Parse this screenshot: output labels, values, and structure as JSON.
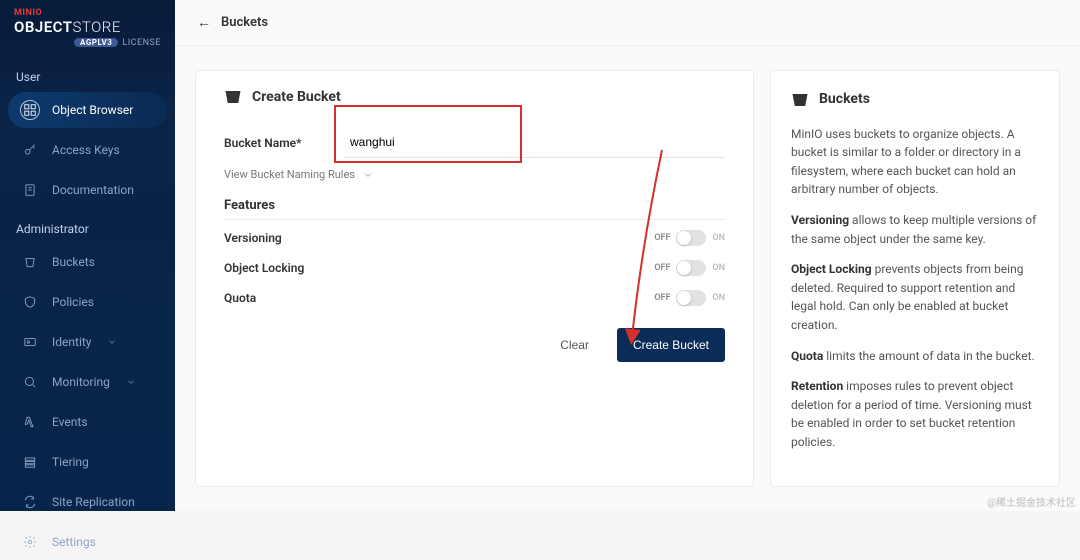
{
  "logo": {
    "brand": "MINIO",
    "title_bold": "OBJECT",
    "title_thin": "STORE",
    "badge": "AGPLV3",
    "license": "LICENSE"
  },
  "topbar": {
    "back_glyph": "←",
    "crumb": "Buckets"
  },
  "sidebar": {
    "user_label": "User",
    "admin_label": "Administrator",
    "items_user": [
      {
        "label": "Object Browser",
        "icon": "grid-icon",
        "active": true
      },
      {
        "label": "Access Keys",
        "icon": "key-icon"
      },
      {
        "label": "Documentation",
        "icon": "doc-icon"
      }
    ],
    "items_admin": [
      {
        "label": "Buckets",
        "icon": "bucket-icon"
      },
      {
        "label": "Policies",
        "icon": "shield-icon"
      },
      {
        "label": "Identity",
        "icon": "id-icon",
        "expandable": true
      },
      {
        "label": "Monitoring",
        "icon": "monitor-icon",
        "expandable": true
      },
      {
        "label": "Events",
        "icon": "lambda-icon"
      },
      {
        "label": "Tiering",
        "icon": "tier-icon"
      },
      {
        "label": "Site Replication",
        "icon": "replication-icon"
      },
      {
        "label": "Settings",
        "icon": "gear-icon"
      }
    ]
  },
  "form": {
    "title": "Create Bucket",
    "field_label": "Bucket Name*",
    "field_value": "wanghui",
    "naming_link": "View Bucket Naming Rules",
    "features_header": "Features",
    "features": [
      {
        "label": "Versioning"
      },
      {
        "label": "Object Locking"
      },
      {
        "label": "Quota"
      }
    ],
    "toggle_off": "OFF",
    "toggle_on": "ON",
    "clear": "Clear",
    "submit": "Create Bucket"
  },
  "help": {
    "title": "Buckets",
    "p0": "MinIO uses buckets to organize objects. A bucket is similar to a folder or directory in a filesystem, where each bucket can hold an arbitrary number of objects.",
    "kw1": "Versioning",
    "p1": " allows to keep multiple versions of the same object under the same key.",
    "kw2": "Object Locking",
    "p2": " prevents objects from being deleted. Required to support retention and legal hold. Can only be enabled at bucket creation.",
    "kw3": "Quota",
    "p3": " limits the amount of data in the bucket.",
    "kw4": "Retention",
    "p4": " imposes rules to prevent object deletion for a period of time. Versioning must be enabled in order to set bucket retention policies."
  },
  "watermark": "@稀土掘金技术社区"
}
